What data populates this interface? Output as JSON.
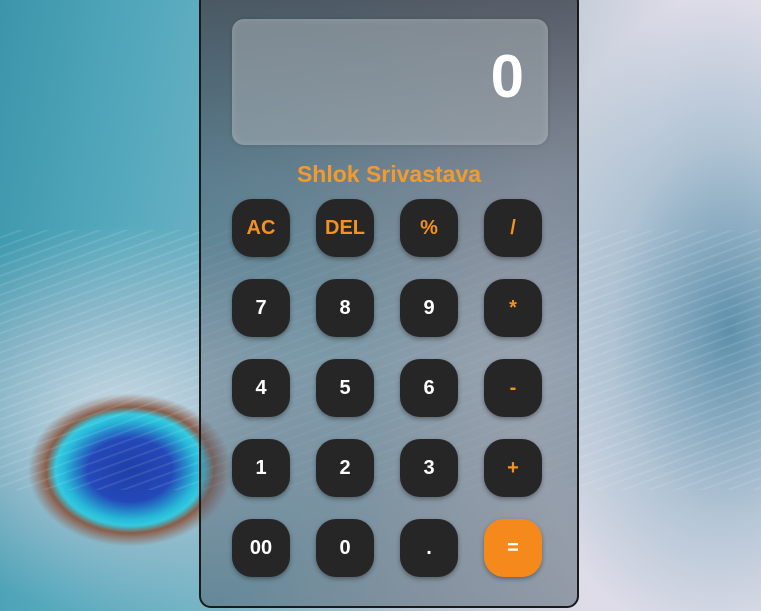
{
  "display": {
    "value": "0"
  },
  "author": "Shlok Srivastava",
  "keys": {
    "ac": "AC",
    "del": "DEL",
    "percent": "%",
    "divide": "/",
    "seven": "7",
    "eight": "8",
    "nine": "9",
    "multiply": "*",
    "four": "4",
    "five": "5",
    "six": "6",
    "minus": "-",
    "one": "1",
    "two": "2",
    "three": "3",
    "plus": "+",
    "double_zero": "00",
    "zero": "0",
    "decimal": ".",
    "equals": "="
  },
  "colors": {
    "accent": "#f5891c",
    "key_background": "#262626",
    "key_text": "#ffffff"
  }
}
